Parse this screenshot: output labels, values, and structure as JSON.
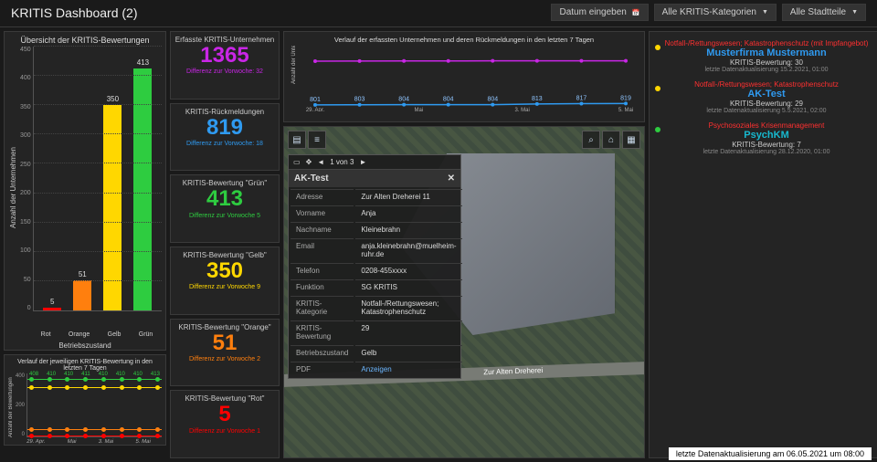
{
  "header": {
    "title": "KRITIS Dashboard (2)",
    "controls": {
      "date_label": "Datum eingeben",
      "cat_label": "Alle KRITIS-Kategorien",
      "district_label": "Alle Stadtteile"
    }
  },
  "bar_panel": {
    "title": "Übersicht der KRITIS-Bewertungen",
    "ylabel": "Anzahl der Unternehmen",
    "xlabel": "Betriebszustand"
  },
  "chart_data": {
    "bar": {
      "type": "bar",
      "categories": [
        "Rot",
        "Orange",
        "Gelb",
        "Grün"
      ],
      "values": [
        5,
        51,
        350,
        413
      ],
      "colors": [
        "#ff0000",
        "#ff7f0e",
        "#ffd700",
        "#2ecc40"
      ],
      "ylim": [
        0,
        450
      ],
      "yticks": [
        0,
        50,
        100,
        150,
        200,
        250,
        300,
        350,
        400,
        450
      ],
      "ylabel": "Anzahl der Unternehmen",
      "xlabel": "Betriebszustand"
    },
    "top_line": {
      "type": "line",
      "title": "Verlauf der erfassten Unternehmen und deren Rückmeldungen in den letzten 7 Tagen",
      "x": [
        "29. Apr.",
        "",
        "Mai",
        "",
        "3. Mai",
        "",
        "5. Mai"
      ],
      "series": [
        {
          "name": "Erfasst",
          "color": "#c926e6",
          "values": [
            1360,
            1362,
            1363,
            1363,
            1364,
            1364,
            1365,
            1365
          ]
        },
        {
          "name": "Rückmeldungen",
          "color": "#2f9af0",
          "values": [
            801,
            803,
            804,
            804,
            804,
            813,
            817,
            819
          ]
        }
      ],
      "ylim_display": [
        800,
        1500
      ]
    },
    "bottom_trend": {
      "type": "line",
      "title": "Verlauf der jeweiligen KRITIS-Bewertung in den letzten 7 Tagen",
      "x": [
        "29. Apr.",
        "",
        "Mai",
        "",
        "3. Mai",
        "",
        "5. Mai",
        ""
      ],
      "yticks": [
        0,
        200,
        400
      ],
      "series": [
        {
          "name": "Grün",
          "color": "#2ecc40",
          "values": [
            408,
            410,
            410,
            411,
            410,
            410,
            410,
            413
          ],
          "label_color": "#2ecc40"
        },
        {
          "name": "Gelb",
          "color": "#ffd700",
          "values": [
            350,
            350,
            350,
            350,
            350,
            350,
            350,
            350
          ]
        },
        {
          "name": "Orange",
          "color": "#ff7f0e",
          "values": [
            51,
            51,
            51,
            51,
            51,
            51,
            51,
            51
          ]
        },
        {
          "name": "Rot",
          "color": "#ff0000",
          "values": [
            5,
            5,
            5,
            5,
            5,
            5,
            5,
            5
          ]
        }
      ],
      "ylim": [
        0,
        450
      ]
    }
  },
  "stats": [
    {
      "label": "Erfasste KRITIS-Unternehmen",
      "value": "1365",
      "diff": "Differenz zur Vorwoche: 32",
      "color": "#c926e6"
    },
    {
      "label": "KRITIS-Rückmeldungen",
      "value": "819",
      "diff": "Differenz zur Vorwoche: 18",
      "color": "#2f9af0"
    },
    {
      "label": "KRITIS-Bewertung \"Grün\"",
      "value": "413",
      "diff": "Differenz zur Vorwoche 5",
      "color": "#2ecc40"
    },
    {
      "label": "KRITIS-Bewertung \"Gelb\"",
      "value": "350",
      "diff": "Differenz zur Vorwoche 9",
      "color": "#ffd700"
    },
    {
      "label": "KRITIS-Bewertung \"Orange\"",
      "value": "51",
      "diff": "Differenz zur Vorwoche 2",
      "color": "#ff7f0e"
    },
    {
      "label": "KRITIS-Bewertung \"Rot\"",
      "value": "5",
      "diff": "Differenz zur Vorwoche 1",
      "color": "#ff0000"
    }
  ],
  "map": {
    "road_label": "Zur Alten Dreherei",
    "popup_nav": "1 von 3",
    "popup_title": "AK-Test",
    "popup_fields": [
      {
        "k": "Adresse",
        "v": "Zur Alten Dreherei 11"
      },
      {
        "k": "Vorname",
        "v": "Anja"
      },
      {
        "k": "Nachname",
        "v": "Kleinebrahn"
      },
      {
        "k": "Email",
        "v": "anja.kleinebrahn@muelheim-ruhr.de"
      },
      {
        "k": "Telefon",
        "v": "0208-455xxxx"
      },
      {
        "k": "Funktion",
        "v": "SG KRITIS"
      },
      {
        "k": "KRITIS-Kategorie",
        "v": "Notfall-/Rettungswesen; Katastrophenschutz"
      },
      {
        "k": "KRITIS-Bewertung",
        "v": "29"
      },
      {
        "k": "Betriebszustand",
        "v": "Gelb"
      },
      {
        "k": "PDF",
        "v": "Anzeigen",
        "link": true
      }
    ]
  },
  "feed": [
    {
      "dot": "#ffd700",
      "cat": "Notfall-/Rettungswesen; Katastrophenschutz (mit Impfangebot)",
      "cat_color": "#ff3030",
      "name": "Musterfirma Mustermann",
      "name_color": "#2f9af0",
      "score": "KRITIS-Bewertung: 30",
      "ts": "letzte Datenaktualisierung 15.2.2021, 01:00"
    },
    {
      "dot": "#ffd700",
      "cat": "Notfall-/Rettungswesen; Katastrophenschutz",
      "cat_color": "#ff3030",
      "name": "AK-Test",
      "name_color": "#2f9af0",
      "score": "KRITIS-Bewertung: 29",
      "ts": "letzte Datenaktualisierung 5.5.2021, 02:00"
    },
    {
      "dot": "#2ecc40",
      "cat": "Psychosoziales Krisenmanagement",
      "cat_color": "#ff3030",
      "name": "PsychKM",
      "name_color": "#17b8ce",
      "score": "KRITIS-Bewertung: 7",
      "ts": "letzte Datenaktualisierung 28.12.2020, 01:00"
    }
  ],
  "footer": "letzte Datenaktualisierung am 06.05.2021 um 08:00"
}
